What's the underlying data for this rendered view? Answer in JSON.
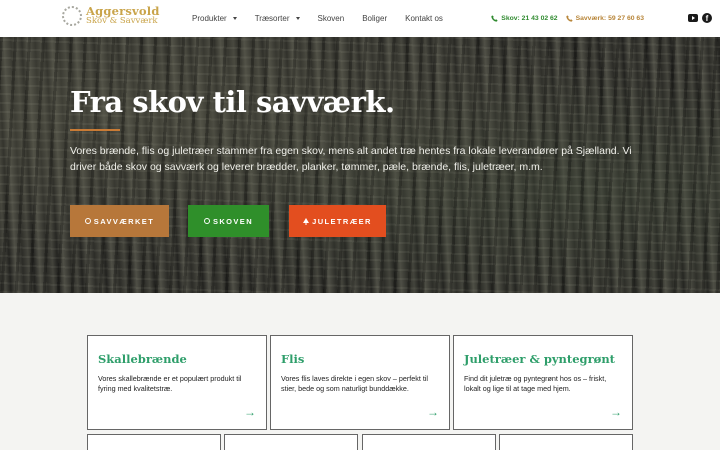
{
  "logo": {
    "name": "Aggersvold",
    "sub": "Skov & Savværk"
  },
  "nav": {
    "items": [
      {
        "label": "Produkter",
        "dropdown": true
      },
      {
        "label": "Træsorter",
        "dropdown": true
      },
      {
        "label": "Skoven",
        "dropdown": false
      },
      {
        "label": "Boliger",
        "dropdown": false
      },
      {
        "label": "Kontakt os",
        "dropdown": false
      }
    ]
  },
  "contact": {
    "skov": "Skov: 21 43 02 62",
    "savvaerk": "Savværk: 59 27 60 63"
  },
  "hero": {
    "title": "Fra skov til savværk.",
    "text": "Vores brænde, flis og juletræer stammer fra egen skov, mens alt andet træ hentes fra lokale leverandører på Sjælland. Vi driver både skov og savværk og leverer brædder, planker, tømmer, pæle, brænde, flis, juletræer, m.m.",
    "buttons": [
      "SAVVÆRKET",
      "SKOVEN",
      "JULETRÆER"
    ]
  },
  "cards": [
    {
      "title": "Skallebrænde",
      "text": "Vores skallebrænde er et populært produkt til fyring med kvalitetstræ."
    },
    {
      "title": "Flis",
      "text": "Vores flis laves direkte i egen skov – perfekt til stier, bede og som naturligt bunddække."
    },
    {
      "title": "Juletræer & pyntegrønt",
      "text": "Find dit juletræ og pyntegrønt hos os – friskt, lokalt og lige til at tage med hjem."
    }
  ],
  "colors": {
    "accent_green": "#2e9e6a",
    "gold": "#c9a44a",
    "btn_savvaerk": "#b7773a",
    "btn_skoven": "#2f8f2a",
    "btn_juletraeer": "#e34e1f"
  },
  "icons": {
    "phone": "phone-icon",
    "youtube": "youtube-icon",
    "facebook": "facebook-icon",
    "arrow": "arrow-right-icon"
  }
}
